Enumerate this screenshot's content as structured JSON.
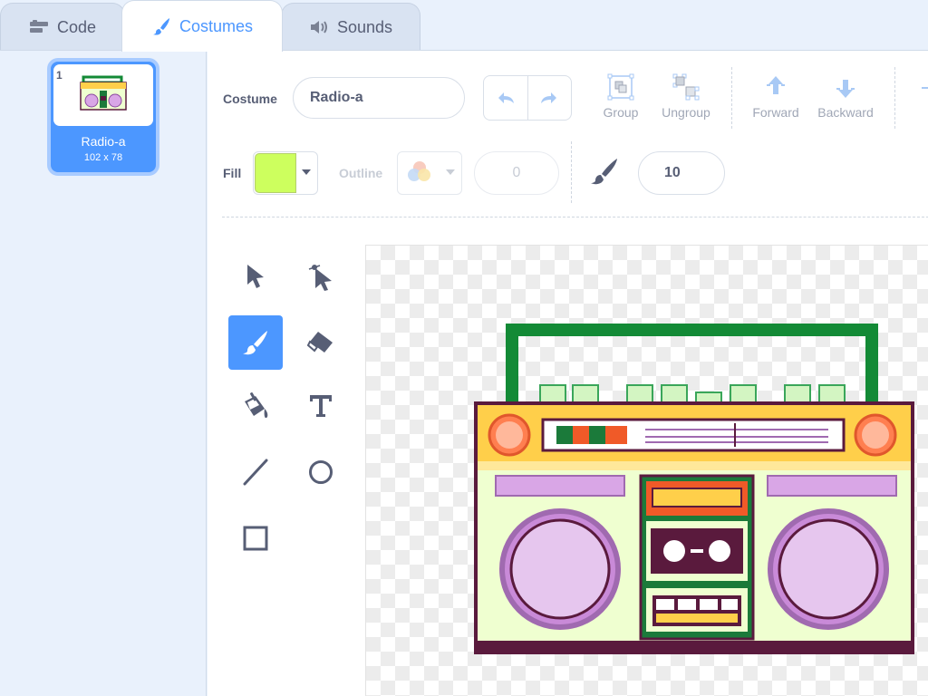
{
  "tabs": [
    {
      "label": "Code",
      "icon": "code-icon"
    },
    {
      "label": "Costumes",
      "icon": "brush-icon"
    },
    {
      "label": "Sounds",
      "icon": "speaker-icon"
    }
  ],
  "costume_list": [
    {
      "number": "1",
      "name": "Radio-a",
      "size": "102 x 78"
    }
  ],
  "toolbar": {
    "costume_label": "Costume",
    "costume_name": "Radio-a",
    "group_label": "Group",
    "ungroup_label": "Ungroup",
    "forward_label": "Forward",
    "backward_label": "Backward",
    "fill_label": "Fill",
    "fill_color": "#cdff5e",
    "outline_label": "Outline",
    "outline_width": "0",
    "brush_size": "10"
  },
  "tools": [
    "select-icon",
    "reshape-icon",
    "brush-icon",
    "eraser-icon",
    "fill-icon",
    "text-icon",
    "line-icon",
    "circle-icon",
    "rectangle-icon"
  ],
  "colors": {
    "accent": "#4c97ff",
    "text": "#575e75",
    "background": "#e9f1fc"
  }
}
